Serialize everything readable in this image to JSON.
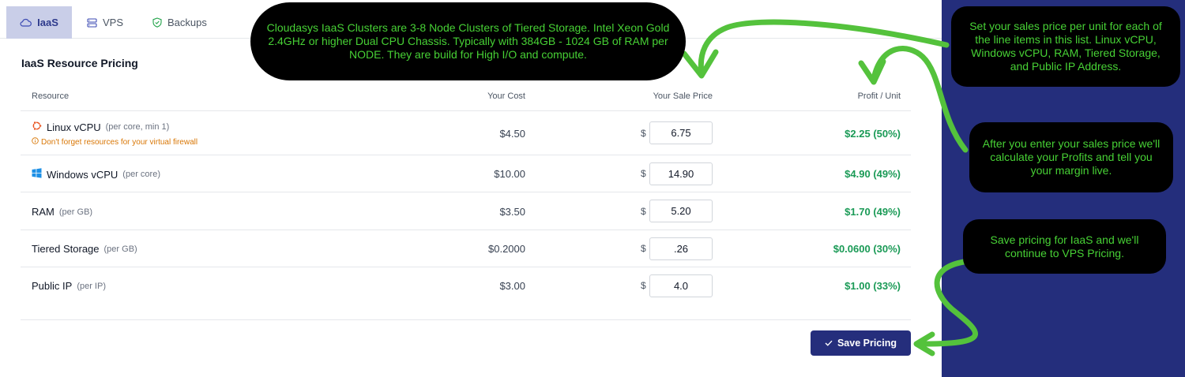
{
  "tabs": [
    {
      "label": "IaaS",
      "icon": "cloud-icon",
      "active": true
    },
    {
      "label": "VPS",
      "icon": "server-icon",
      "active": false
    },
    {
      "label": "Backups",
      "icon": "shield-check-icon",
      "active": false
    }
  ],
  "section_title": "IaaS Resource Pricing",
  "table": {
    "headers": {
      "resource": "Resource",
      "cost": "Your Cost",
      "sale": "Your Sale Price",
      "profit": "Profit / Unit"
    },
    "currency_symbol": "$",
    "rows": [
      {
        "name": "Linux vCPU",
        "unit": "(per core, min 1)",
        "icon": "ubuntu-icon",
        "note": "Don't forget resources for your virtual firewall",
        "cost": "$4.50",
        "sale": "6.75",
        "profit": "$2.25 (50%)"
      },
      {
        "name": "Windows vCPU",
        "unit": "(per core)",
        "icon": "windows-icon",
        "note": "",
        "cost": "$10.00",
        "sale": "14.90",
        "profit": "$4.90 (49%)"
      },
      {
        "name": "RAM",
        "unit": "(per GB)",
        "icon": "",
        "note": "",
        "cost": "$3.50",
        "sale": "5.20",
        "profit": "$1.70 (49%)"
      },
      {
        "name": "Tiered Storage",
        "unit": "(per GB)",
        "icon": "",
        "note": "",
        "cost": "$0.2000",
        "sale": ".26",
        "profit": "$0.0600 (30%)"
      },
      {
        "name": "Public IP",
        "unit": "(per IP)",
        "icon": "",
        "note": "",
        "cost": "$3.00",
        "sale": "4.0",
        "profit": "$1.00 (33%)"
      }
    ]
  },
  "save_button": {
    "label": "Save Pricing",
    "icon": "check-icon"
  },
  "annotations": {
    "clusters": "Cloudasys IaaS Clusters are 3-8 Node Clusters of Tiered Storage. Intel Xeon Gold 2.4GHz or higher Dual CPU Chassis. Typically with 384GB - 1024 GB of RAM per NODE. They are build for High I/O and compute.",
    "set_price": "Set your sales price per unit for each of the line items in this list. Linux vCPU, Windows vCPU, RAM, Tiered Storage, and Public IP Address.",
    "profits": "After you enter your sales price we'll calculate your Profits and tell you your margin live.",
    "save": "Save pricing for IaaS and we'll continue to VPS Pricing."
  },
  "colors": {
    "accent": "#252e7c",
    "tab_active_bg": "#c9cee8",
    "profit_green": "#1a9a56",
    "warning": "#d97706",
    "annotation_text": "#47d135",
    "arrow": "#54c23c"
  }
}
